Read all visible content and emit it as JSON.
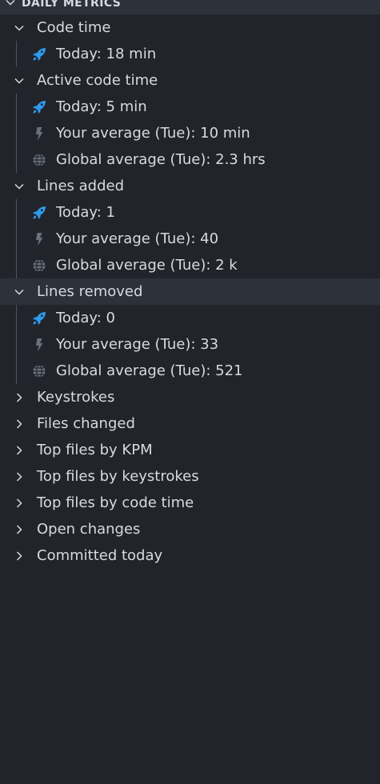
{
  "section": {
    "title": "DAILY METRICS"
  },
  "colors": {
    "background": "#21252b",
    "header_background": "#2c313a",
    "text": "#d7dae0",
    "rocket_icon": "#2f9bee",
    "muted_icon": "#6b717d"
  },
  "groups": [
    {
      "label": "Code time",
      "expanded": true,
      "items": [
        {
          "icon": "rocket-icon",
          "label": "Today: 18 min"
        }
      ]
    },
    {
      "label": "Active code time",
      "expanded": true,
      "items": [
        {
          "icon": "rocket-icon",
          "label": "Today: 5 min"
        },
        {
          "icon": "lightning-icon",
          "label": "Your average (Tue): 10 min"
        },
        {
          "icon": "globe-icon",
          "label": "Global average (Tue): 2.3 hrs"
        }
      ]
    },
    {
      "label": "Lines added",
      "expanded": true,
      "items": [
        {
          "icon": "rocket-icon",
          "label": "Today: 1"
        },
        {
          "icon": "lightning-icon",
          "label": "Your average (Tue): 40"
        },
        {
          "icon": "globe-icon",
          "label": "Global average (Tue): 2 k"
        }
      ]
    },
    {
      "label": "Lines removed",
      "expanded": true,
      "selected": true,
      "items": [
        {
          "icon": "rocket-icon",
          "label": "Today: 0"
        },
        {
          "icon": "lightning-icon",
          "label": "Your average (Tue): 33"
        },
        {
          "icon": "globe-icon",
          "label": "Global average (Tue): 521"
        }
      ]
    },
    {
      "label": "Keystrokes",
      "expanded": false,
      "items": []
    },
    {
      "label": "Files changed",
      "expanded": false,
      "items": []
    },
    {
      "label": "Top files by KPM",
      "expanded": false,
      "items": []
    },
    {
      "label": "Top files by keystrokes",
      "expanded": false,
      "items": []
    },
    {
      "label": "Top files by code time",
      "expanded": false,
      "items": []
    },
    {
      "label": "Open changes",
      "expanded": false,
      "items": []
    },
    {
      "label": "Committed today",
      "expanded": false,
      "items": []
    }
  ]
}
